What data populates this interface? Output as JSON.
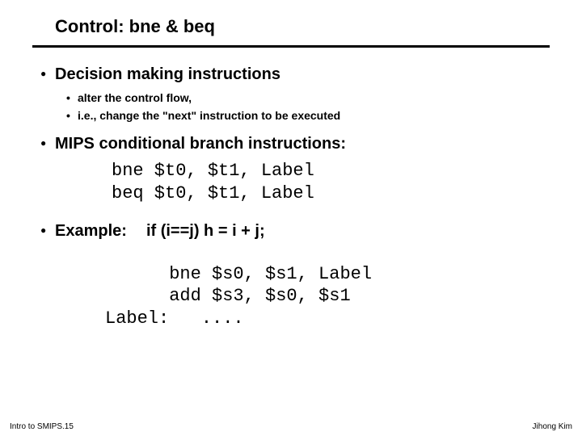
{
  "title": "Control: bne & beq",
  "bullet1": "Decision making instructions",
  "sub1": "alter the control flow,",
  "sub2": "i.e., change the \"next\" instruction to be executed",
  "bullet2": "MIPS conditional branch instructions:",
  "code1_line1": "bne $t0, $t1, Label",
  "code1_line2": "beq $t0, $t1, Label",
  "bullet3": "Example:",
  "example_stmt": "if (i==j) h = i + j;",
  "code2_line1": "      bne $s0, $s1, Label",
  "code2_line2": "      add $s3, $s0, $s1",
  "code2_line3": "Label:   ....",
  "footer_left": "Intro to SMIPS.15",
  "footer_right": "Jihong Kim"
}
